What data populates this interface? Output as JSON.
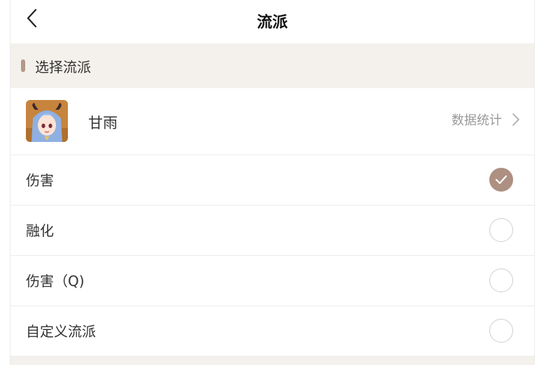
{
  "header": {
    "title": "流派",
    "back_icon": "chevron-left-icon"
  },
  "section": {
    "label": "选择流派",
    "accent_color": "#b49888"
  },
  "character": {
    "name": "甘雨",
    "stats_label": "数据统计",
    "avatar_icon": "character-avatar"
  },
  "options": [
    {
      "label": "伤害",
      "selected": true
    },
    {
      "label": "融化",
      "selected": false
    },
    {
      "label": "伤害（Q)",
      "selected": false
    },
    {
      "label": "自定义流派",
      "selected": false
    }
  ],
  "colors": {
    "selected": "#ad9082",
    "section_bg": "#f4f1ec"
  }
}
